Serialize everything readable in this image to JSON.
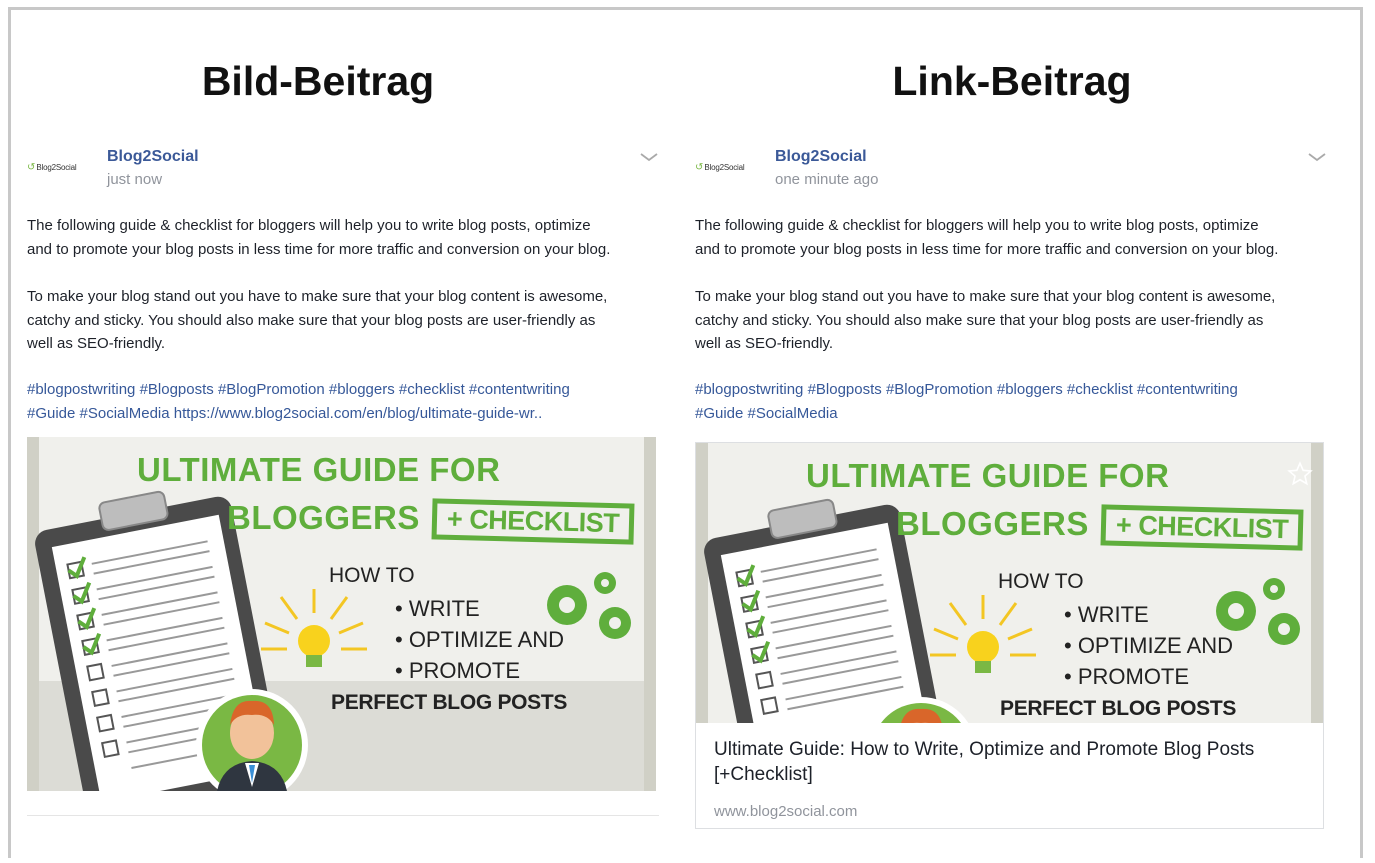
{
  "left": {
    "heading": "Bild-Beitrag",
    "author": "Blog2Social",
    "time": "just now",
    "paragraph1_line1": "The following guide & checklist for bloggers will help you to write blog posts, optimize",
    "paragraph1_line2": "and to promote your blog posts in less time for more traffic and conversion on your blog.",
    "paragraph2_line1": "To make your blog stand out you have to make sure that your blog content is awesome,",
    "paragraph2_line2": "catchy and sticky. You should also make sure that your blog posts are user-friendly as",
    "paragraph2_line3": "well as SEO-friendly.",
    "hashtags_line1": "#blogpostwriting #Blogposts #BlogPromotion #bloggers #checklist #contentwriting",
    "hashtags_line2": "#Guide #SocialMedia https://www.blog2social.com/en/blog/ultimate-guide-wr.."
  },
  "right": {
    "heading": "Link-Beitrag",
    "author": "Blog2Social",
    "time": "one minute ago",
    "paragraph1_line1": "The following guide & checklist for bloggers will help you to write blog posts, optimize",
    "paragraph1_line2": "and to promote your blog posts in less time for more traffic and conversion on your blog.",
    "paragraph2_line1": "To make your blog stand out you have to make sure that your blog content is awesome,",
    "paragraph2_line2": "catchy and sticky. You should also make sure that your blog posts are user-friendly as",
    "paragraph2_line3": "well as SEO-friendly.",
    "hashtags_line1": "#blogpostwriting #Blogposts #BlogPromotion #bloggers #checklist #contentwriting",
    "hashtags_line2": "#Guide #SocialMedia",
    "link_title_line1": "Ultimate Guide: How to Write, Optimize and Promote Blog Posts",
    "link_title_line2": "[+Checklist]",
    "link_url": "www.blog2social.com"
  },
  "logo": {
    "text": "Blog2Social"
  },
  "banner": {
    "line1": "ULTIMATE GUIDE FOR",
    "line2": "BLOGGERS",
    "stamp": "+ CHECKLIST",
    "how_to": "HOW TO",
    "bullet1": "• WRITE",
    "bullet2": "• OPTIMIZE AND",
    "bullet3": "• PROMOTE",
    "perfect": "PERFECT BLOG POSTS"
  },
  "colors": {
    "brand_green": "#5fae3c",
    "link_blue": "#365899",
    "author_blue": "#3b5998",
    "muted": "#90949c"
  },
  "icons": [
    "chevron-down-icon",
    "star-icon",
    "clipboard-icon",
    "lightbulb-icon",
    "gear-icon",
    "avatar-icon"
  ]
}
